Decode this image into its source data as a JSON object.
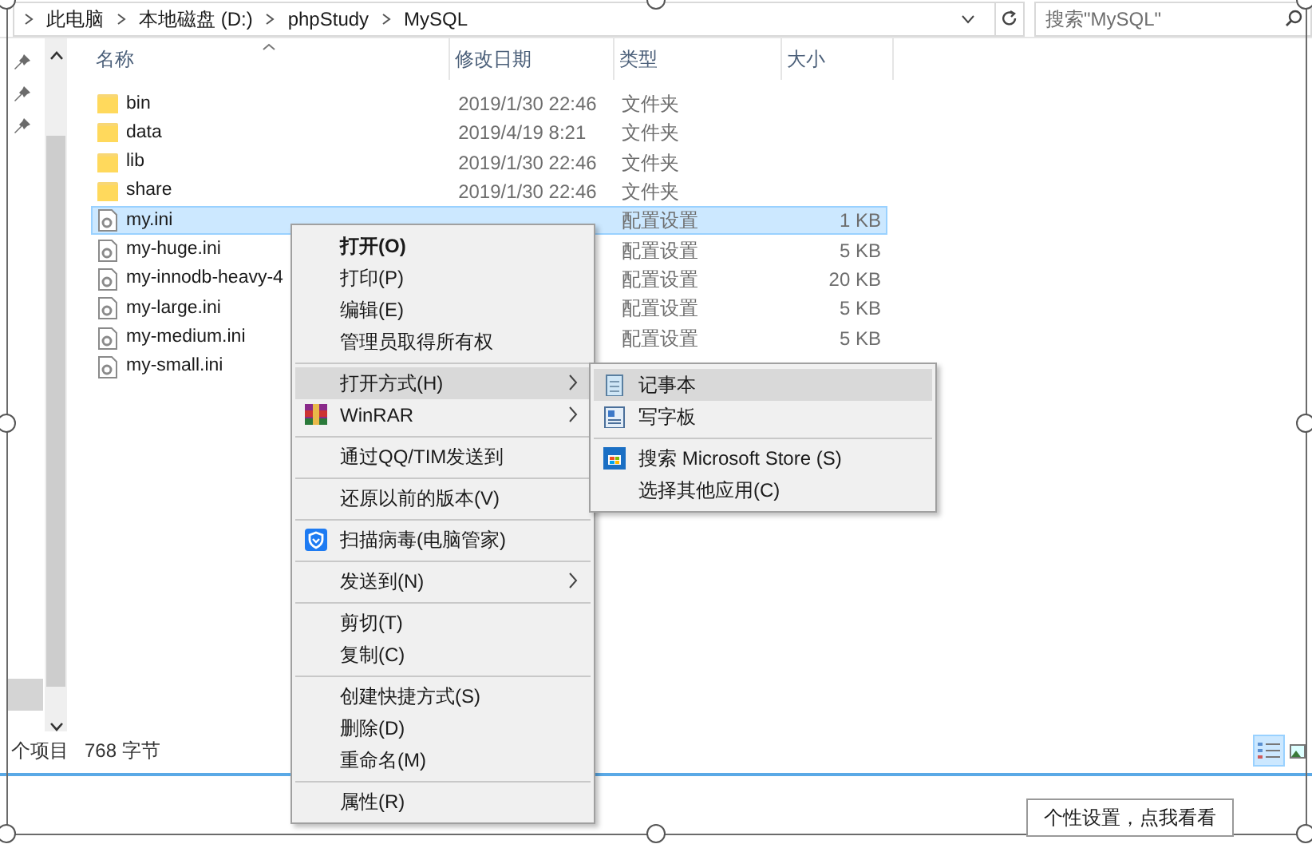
{
  "breadcrumb": [
    "此电脑",
    "本地磁盘 (D:)",
    "phpStudy",
    "MySQL"
  ],
  "search": {
    "placeholder": "搜索\"MySQL\""
  },
  "columns": [
    "名称",
    "修改日期",
    "类型",
    "大小"
  ],
  "files": [
    {
      "kind": "folder",
      "name": "bin",
      "date": "2019/1/30 22:46",
      "type": "文件夹",
      "selected": false
    },
    {
      "kind": "folder",
      "name": "data",
      "date": "2019/4/19 8:21",
      "type": "文件夹",
      "selected": false
    },
    {
      "kind": "folder",
      "name": "lib",
      "date": "2019/1/30 22:46",
      "type": "文件夹",
      "selected": false
    },
    {
      "kind": "folder",
      "name": "share",
      "date": "2019/1/30 22:46",
      "type": "文件夹",
      "selected": false
    },
    {
      "kind": "file",
      "name": "my.ini",
      "type": "配置设置",
      "size": "1 KB",
      "selected": true
    },
    {
      "kind": "file",
      "name": "my-huge.ini",
      "type": "配置设置",
      "size": "5 KB",
      "selected": false
    },
    {
      "kind": "file",
      "name": "my-innodb-heavy-4",
      "type": "配置设置",
      "size": "20 KB",
      "selected": false
    },
    {
      "kind": "file",
      "name": "my-large.ini",
      "type": "配置设置",
      "size": "5 KB",
      "selected": false
    },
    {
      "kind": "file",
      "name": "my-medium.ini",
      "type": "配置设置",
      "size": "5 KB",
      "selected": false
    },
    {
      "kind": "file",
      "name": "my-small.ini",
      "selected": false
    }
  ],
  "status_bar": {
    "items": "个项目",
    "selection": "768 字节"
  },
  "context_menu": [
    {
      "kind": "item",
      "label": "打开(O)",
      "bold": true,
      "selected": false
    },
    {
      "kind": "item",
      "label": "打印(P)",
      "selected": false
    },
    {
      "kind": "item",
      "label": "编辑(E)",
      "selected": false
    },
    {
      "kind": "item",
      "label": "管理员取得所有权",
      "selected": false
    },
    {
      "kind": "separator"
    },
    {
      "kind": "item",
      "label": "打开方式(H)",
      "submenu": true,
      "selected": true
    },
    {
      "kind": "item",
      "label": "WinRAR",
      "submenu": true,
      "selected": false
    },
    {
      "kind": "separator"
    },
    {
      "kind": "item",
      "label": "通过QQ/TIM发送到",
      "selected": false
    },
    {
      "kind": "separator"
    },
    {
      "kind": "item",
      "label": "还原以前的版本(V)",
      "selected": false
    },
    {
      "kind": "separator"
    },
    {
      "kind": "item",
      "label": "扫描病毒(电脑管家)",
      "selected": false
    },
    {
      "kind": "separator"
    },
    {
      "kind": "item",
      "label": "发送到(N)",
      "submenu": true,
      "selected": false
    },
    {
      "kind": "separator"
    },
    {
      "kind": "item",
      "label": "剪切(T)",
      "selected": false
    },
    {
      "kind": "item",
      "label": "复制(C)",
      "selected": false
    },
    {
      "kind": "separator"
    },
    {
      "kind": "item",
      "label": "创建快捷方式(S)",
      "selected": false
    },
    {
      "kind": "item",
      "label": "删除(D)",
      "selected": false
    },
    {
      "kind": "item",
      "label": "重命名(M)",
      "selected": false
    },
    {
      "kind": "separator"
    },
    {
      "kind": "item",
      "label": "属性(R)",
      "selected": false
    }
  ],
  "open_with_menu": [
    {
      "kind": "item",
      "label": "记事本",
      "selected": true
    },
    {
      "kind": "item",
      "label": "写字板",
      "selected": false
    },
    {
      "kind": "separator"
    },
    {
      "kind": "item",
      "label": "搜索 Microsoft Store (S)",
      "selected": false
    },
    {
      "kind": "item",
      "label": "选择其他应用(C)",
      "selected": false
    }
  ],
  "tooltip": "个性设置，点我看看"
}
